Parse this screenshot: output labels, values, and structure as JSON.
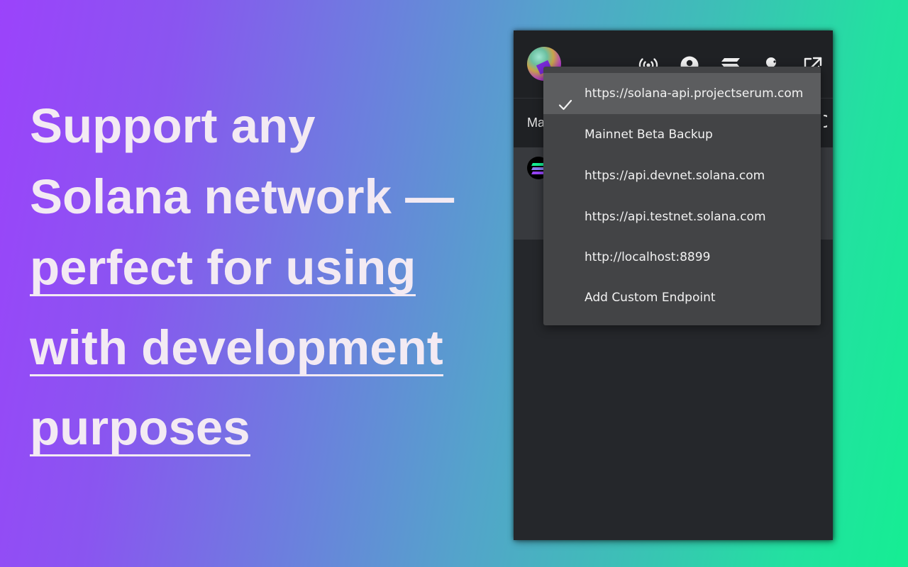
{
  "headline": {
    "line1": "Support any",
    "line2": "Solana network —",
    "line3": "perfect for using",
    "line4": "with development",
    "line5": "purposes"
  },
  "popup": {
    "icons": [
      "network-icon",
      "account-icon",
      "solana-icon",
      "user-icon",
      "external-link-icon"
    ],
    "tab_label": "Ma",
    "network_menu": {
      "items": [
        {
          "label": "https://solana-api.projectserum.com",
          "selected": true
        },
        {
          "label": "Mainnet Beta Backup",
          "selected": false
        },
        {
          "label": "https://api.devnet.solana.com",
          "selected": false
        },
        {
          "label": "https://api.testnet.solana.com",
          "selected": false
        },
        {
          "label": "http://localhost:8899",
          "selected": false
        },
        {
          "label": "Add Custom Endpoint",
          "selected": false
        }
      ]
    }
  },
  "colors": {
    "gradient_start": "#9b43fb",
    "gradient_end": "#15ee93",
    "popup_bg": "#25272b",
    "menu_bg": "#434446",
    "menu_selected_bg": "#5c5d5f",
    "headline_text": "#f3eaf3"
  }
}
